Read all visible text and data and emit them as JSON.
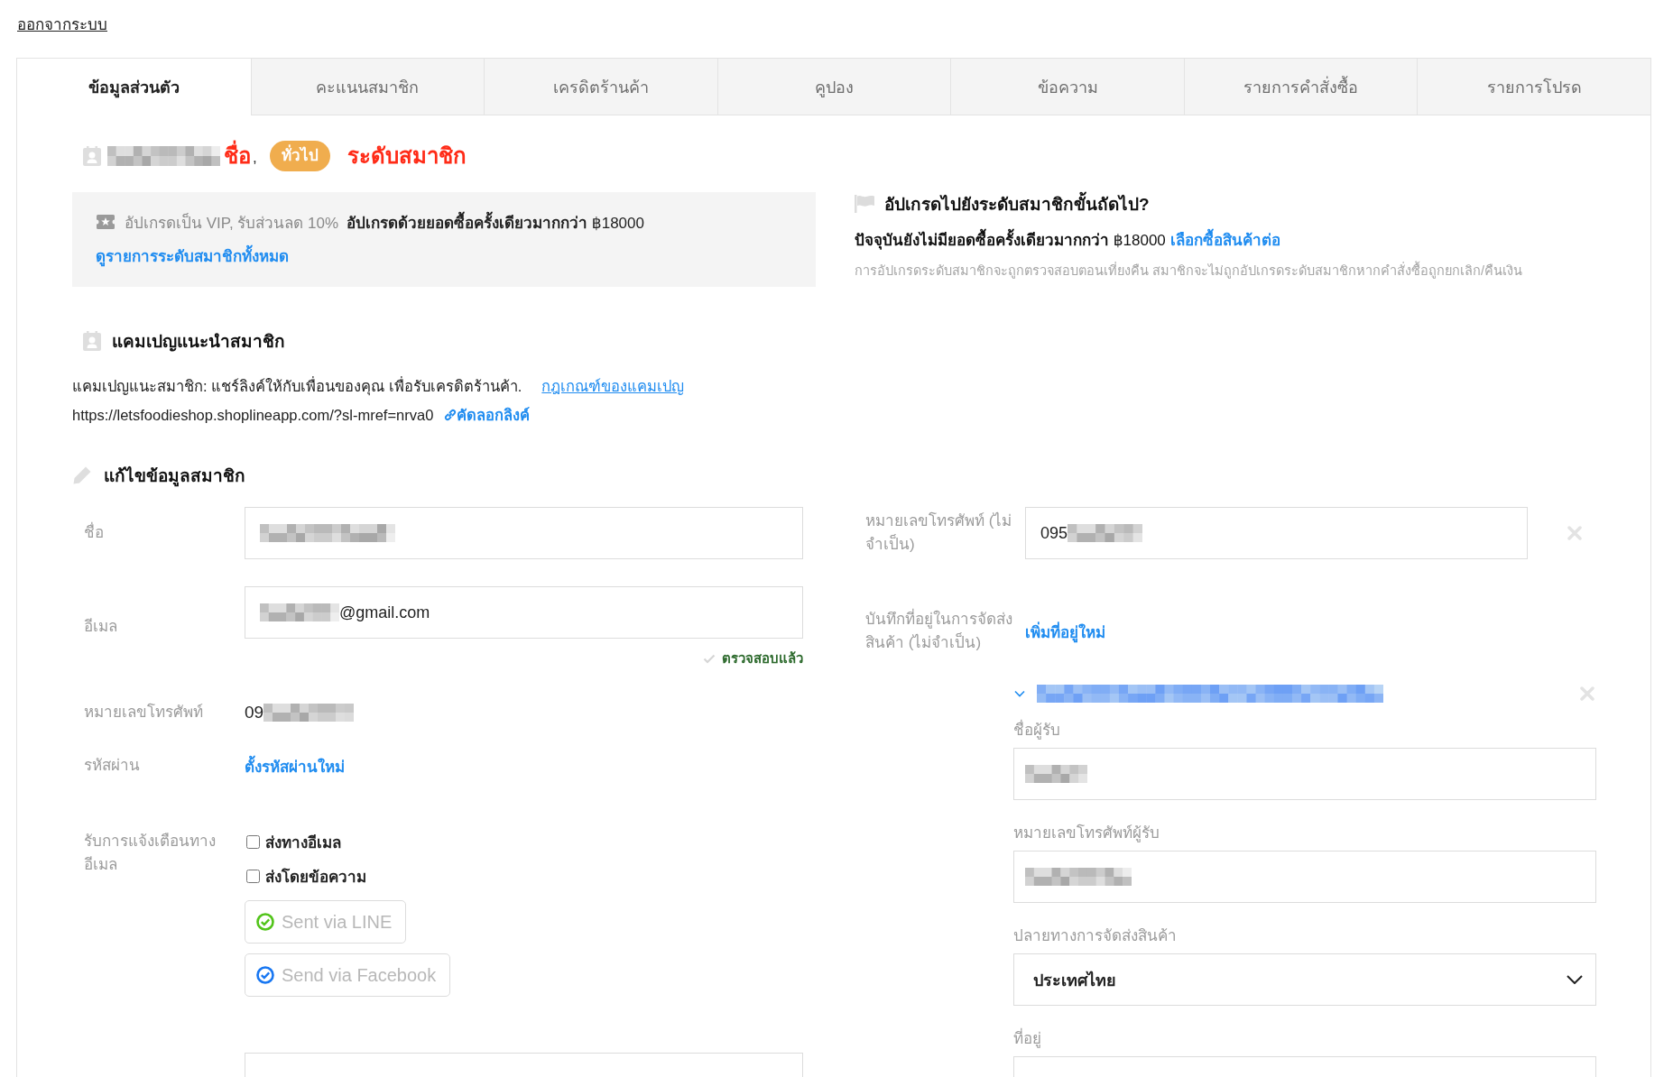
{
  "logout_link": "ออกจากระบบ",
  "tabs": [
    {
      "label": "ข้อมูลส่วนตัว",
      "selected": true
    },
    {
      "label": "คะแนนสมาชิก",
      "selected": false
    },
    {
      "label": "เครดิตร้านค้า",
      "selected": false
    },
    {
      "label": "คูปอง",
      "selected": false
    },
    {
      "label": "ข้อความ",
      "selected": false
    },
    {
      "label": "รายการคำสั่งซื้อ",
      "selected": false
    },
    {
      "label": "รายการโปรด",
      "selected": false
    }
  ],
  "member": {
    "name_parts": [
      {
        "kind": "redacted"
      },
      {
        "kind": "text",
        "text": "ชื่อ"
      }
    ],
    "separator": ",",
    "tier_badge": "ทั่วไป",
    "tier_label": "ระดับสมาชิก"
  },
  "upgrade_box": {
    "offer": "อัปเกรดเป็น VIP, รับส่วนลด 10%",
    "condition": "**อัปเกรดด้วยยอดซื้อครั้งเดียวมากกว่า** ฿18000",
    "link": "ดูรายการระดับสมาชิกทั้งหมด"
  },
  "next_tier": {
    "title": "อัปเกรดไปยังระดับสมาชิกขั้นถัดไป?",
    "status": "**ปัจจุบันยังไม่มียอดซื้อครั้งเดียวมากกว่า** ฿18000",
    "link": "เลือกซื้อสินค้าต่อ",
    "note": "การอัปเกรดระดับสมาชิกจะถูกตรวจสอบตอนเที่ยงคืน สมาชิกจะไม่ถูกอัปเกรดระดับสมาชิกหากคำสั่งซื้อถูกยกเลิก/คืนเงิน"
  },
  "referral": {
    "title": "แคมเปญแนะนำสมาชิก",
    "description": "แคมเปญแนะสมาชิก: แชร์ลิงค์ให้กับเพื่อนของคุณ เพื่อรับเครดิตร้านค้า.",
    "rules_link": "กฎเกณฑ์ของแคมเปญ",
    "url": "https://letsfoodieshop.shoplineapp.com/?sl-mref=nrva0",
    "copy_link": "คัดลอกลิงค์"
  },
  "edit_profile": {
    "title": "แก้ไขข้อมูลสมาชิก",
    "fields": [
      {
        "kind": "input",
        "label": "ชื่อ",
        "value_parts": [
          {
            "kind": "redacted"
          }
        ]
      },
      {
        "kind": "input",
        "label": "อีเมล",
        "value_parts": [
          {
            "kind": "redacted"
          },
          {
            "kind": "text",
            "text": "@gmail.com"
          }
        ],
        "verified": true,
        "verified_label": "ตรวจสอบแล้ว"
      },
      {
        "kind": "text",
        "label": "หมายเลขโทรศัพท์",
        "value_parts": [
          {
            "kind": "text",
            "text": "09"
          },
          {
            "kind": "redacted"
          }
        ]
      },
      {
        "kind": "link",
        "label": "รหัสผ่าน",
        "link": "ตั้งรหัสผ่านใหม่"
      },
      {
        "kind": "notifications",
        "label": "รับการแจ้งเตือนทางอีเมล",
        "options": [
          {
            "label": "ส่งทางอีเมล",
            "checked": false
          },
          {
            "label": "ส่งโดยข้อความ",
            "checked": false
          }
        ],
        "buttons": [
          {
            "kind": "line",
            "label": "Sent via LINE"
          },
          {
            "kind": "facebook",
            "label": "Send via Facebook"
          }
        ]
      },
      {
        "kind": "input"
      }
    ],
    "right_fields": [
      {
        "kind": "input",
        "label": "หมายเลขโทรศัพท์ (ไม่จำเป็น)",
        "value_parts": [
          {
            "kind": "text",
            "text": "095"
          },
          {
            "kind": "redacted"
          }
        ],
        "clearable": true
      },
      {
        "kind": "address_book",
        "label": "บันทึกที่อยู่ในการจัดส่งสินค้า (ไม่จำเป็น)",
        "link": "เพิ่มที่อยู่ใหม่",
        "addresses": [
          {
            "expanded": true,
            "removable": true,
            "title_parts": [
              {
                "kind": "redacted"
              }
            ],
            "fields": [
              {
                "kind": "input",
                "label": "ชื่อผู้รับ",
                "value_parts": [
                  {
                    "kind": "redacted"
                  }
                ]
              },
              {
                "kind": "input",
                "label": "หมายเลขโทรศัพท์ผู้รับ",
                "value_parts": [
                  {
                    "kind": "redacted"
                  }
                ]
              },
              {
                "kind": "select",
                "label": "ปลายทางการจัดส่งสินค้า",
                "value": "ประเทศไทย"
              },
              {
                "kind": "input",
                "label": "ที่อยู่"
              }
            ]
          }
        ]
      }
    ]
  }
}
